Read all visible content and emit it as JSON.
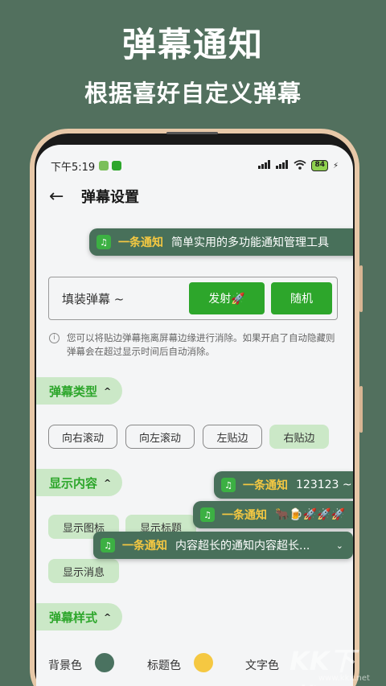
{
  "promo": {
    "headline": "弹幕通知",
    "subline": "根据喜好自定义弹幕"
  },
  "statusbar": {
    "time": "下午5:19",
    "battery": "84"
  },
  "appbar": {
    "title": "弹幕设置"
  },
  "notifications": [
    {
      "title": "一条通知",
      "message": "简单实用的多功能通知管理工具"
    },
    {
      "title": "一条通知",
      "message": "123123 ~"
    },
    {
      "title": "一条通知",
      "message": "🐂🍺🚀🚀🚀"
    },
    {
      "title": "一条通知",
      "message": "内容超长的通知内容超长..."
    }
  ],
  "danmaku_input": {
    "placeholder": "填装弹幕 ~",
    "fire_label": "发射🚀",
    "random_label": "随机"
  },
  "hint": "您可以将贴边弹幕拖离屏幕边缘进行消除。如果开启了自动隐藏则弹幕会在超过显示时间后自动消除。",
  "sections": {
    "type": {
      "label": "弹幕类型",
      "options": [
        "向右滚动",
        "向左滚动",
        "左贴边",
        "右贴边"
      ],
      "selected": "右贴边"
    },
    "content": {
      "label": "显示内容",
      "options": [
        "显示图标",
        "显示标题",
        "显示消息"
      ]
    },
    "style": {
      "label": "弹幕样式",
      "bg_label": "背景色",
      "title_label": "标题色",
      "text_label": "文字色"
    }
  },
  "colors": {
    "background": "#52705e",
    "accent": "#2da62b",
    "bg_color": "#4a7260",
    "title_color": "#f5c842"
  },
  "watermark": {
    "logo": "KK下载",
    "url": "www.kkx.net"
  }
}
